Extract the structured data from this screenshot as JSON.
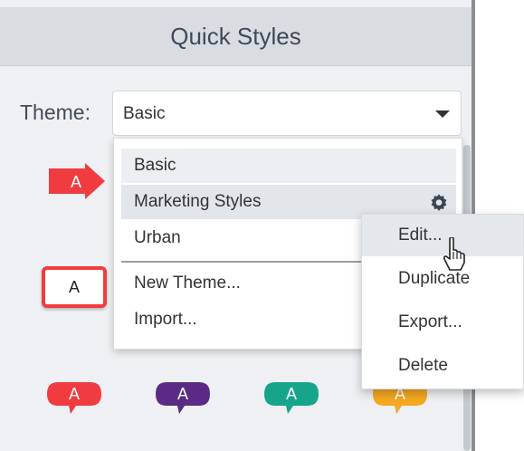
{
  "header": {
    "title": "Quick Styles"
  },
  "theme": {
    "label": "Theme:",
    "selected_value": "Basic"
  },
  "dropdown": {
    "items": [
      {
        "label": "Basic"
      },
      {
        "label": "Marketing Styles"
      },
      {
        "label": "Urban"
      },
      {
        "label": "New Theme..."
      },
      {
        "label": "Import..."
      }
    ],
    "item_icon": "gear-icon"
  },
  "context_menu": {
    "items": [
      {
        "label": "Edit..."
      },
      {
        "label": "Duplicate"
      },
      {
        "label": "Export..."
      },
      {
        "label": "Delete"
      }
    ]
  },
  "swatches": {
    "arrow_label": "A",
    "box_label": "A",
    "bubbles": [
      {
        "label": "A",
        "color": "#f03c40"
      },
      {
        "label": "A",
        "color": "#5b2a86"
      },
      {
        "label": "A",
        "color": "#16a58a"
      },
      {
        "label": "A",
        "color": "#f6a821"
      }
    ]
  },
  "colors": {
    "accent_red": "#f03c40",
    "header_bg": "#d9dde2",
    "panel_bg": "#eef0f3"
  }
}
